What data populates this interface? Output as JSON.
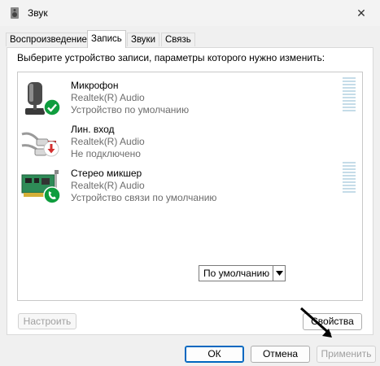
{
  "window": {
    "title": "Звук",
    "close_glyph": "✕"
  },
  "tabs": [
    {
      "label": "Воспроизведение",
      "active": false
    },
    {
      "label": "Запись",
      "active": true
    },
    {
      "label": "Звуки",
      "active": false
    },
    {
      "label": "Связь",
      "active": false
    }
  ],
  "panel": {
    "instruction": "Выберите устройство записи, параметры которого нужно изменить:"
  },
  "devices": [
    {
      "name": "Микрофон",
      "driver": "Realtek(R) Audio",
      "status": "Устройство по умолчанию",
      "icon": "microphone-icon",
      "badge": "check-badge-icon"
    },
    {
      "name": "Лин. вход",
      "driver": "Realtek(R) Audio",
      "status": "Не подключено",
      "icon": "line-in-cable-icon",
      "badge": "down-arrow-badge-icon"
    },
    {
      "name": "Стерео микшер",
      "driver": "Realtek(R) Audio",
      "status": "Устройство связи по умолчанию",
      "icon": "sound-card-icon",
      "badge": "phone-badge-icon"
    }
  ],
  "buttons": {
    "configure": "Настроить",
    "set_default": "По умолчанию",
    "properties": "Свойства",
    "ok": "ОК",
    "cancel": "Отмена",
    "apply": "Применить"
  },
  "colors": {
    "accent": "#0067c0",
    "check": "#0f9d3e",
    "arrow_badge": "#d32f2f",
    "meter": "#c5dce8"
  }
}
